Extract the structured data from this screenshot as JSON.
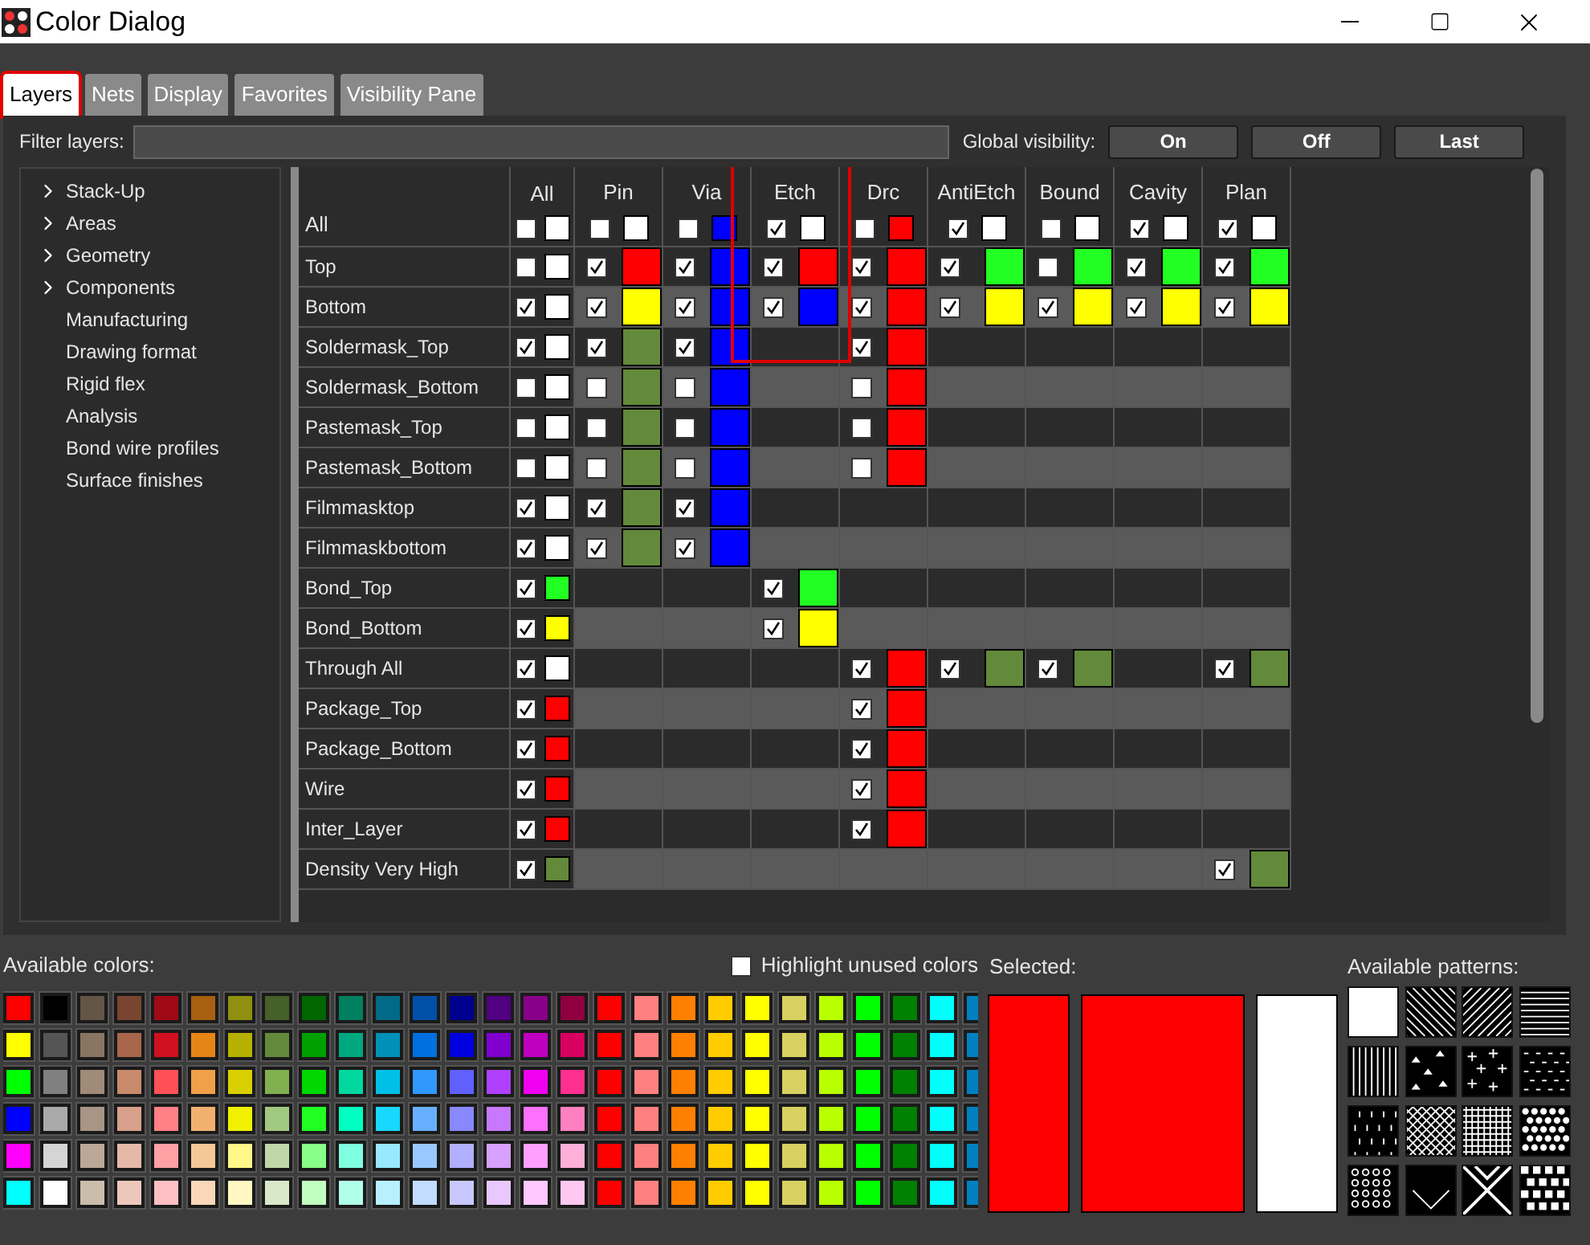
{
  "window": {
    "title": "Color Dialog"
  },
  "tabs": [
    {
      "label": "Layers",
      "selected": true,
      "highlighted": true
    },
    {
      "label": "Nets",
      "selected": false,
      "highlighted": false
    },
    {
      "label": "Display",
      "selected": false,
      "highlighted": false
    },
    {
      "label": "Favorites",
      "selected": false,
      "highlighted": false
    },
    {
      "label": "Visibility Pane",
      "selected": false,
      "highlighted": false
    }
  ],
  "filter": {
    "label": "Filter layers:"
  },
  "global_visibility": {
    "label": "Global visibility:",
    "buttons": [
      "On",
      "Off",
      "Last"
    ]
  },
  "tree": [
    {
      "label": "Stack-Up",
      "kind": "group"
    },
    {
      "label": "Areas",
      "kind": "group"
    },
    {
      "label": "Geometry",
      "kind": "group"
    },
    {
      "label": "Components",
      "kind": "group"
    },
    {
      "label": "Manufacturing",
      "kind": "leaf"
    },
    {
      "label": "Drawing format",
      "kind": "leaf"
    },
    {
      "label": "Rigid flex",
      "kind": "leaf"
    },
    {
      "label": "Analysis",
      "kind": "leaf"
    },
    {
      "label": "Bond wire profiles",
      "kind": "leaf"
    },
    {
      "label": "Surface finishes",
      "kind": "leaf"
    }
  ],
  "grid": {
    "all_row_label": "All",
    "all_column": {
      "label": "All",
      "checked": false,
      "color": "#ffffff"
    },
    "columns": [
      {
        "label": "Pin",
        "checked": false,
        "color": "#ffffff"
      },
      {
        "label": "Via",
        "checked": false,
        "color": "#0000ff"
      },
      {
        "label": "Etch",
        "checked": true,
        "color": "#ffffff",
        "highlighted": true
      },
      {
        "label": "Drc",
        "checked": false,
        "color": "#ff0000"
      },
      {
        "label": "AntiEtch",
        "checked": true,
        "color": "#ffffff"
      },
      {
        "label": "Bound",
        "checked": false,
        "color": "#ffffff"
      },
      {
        "label": "Cavity",
        "checked": true,
        "color": "#ffffff"
      },
      {
        "label": "Plan",
        "checked": true,
        "color": "#ffffff"
      }
    ],
    "rows": [
      {
        "name": "Top",
        "all": {
          "checked": false,
          "color": "#ffffff"
        },
        "cells": [
          {
            "checked": true,
            "color": "#ff0000"
          },
          {
            "checked": true,
            "color": "#0000ff"
          },
          {
            "checked": true,
            "color": "#ff0000"
          },
          {
            "checked": true,
            "color": "#ff0000"
          },
          {
            "checked": true,
            "color": "#22ff22"
          },
          {
            "checked": false,
            "color": "#22ff22"
          },
          {
            "checked": true,
            "color": "#22ff22"
          },
          {
            "checked": true,
            "color": "#22ff22"
          }
        ]
      },
      {
        "name": "Bottom",
        "all": {
          "checked": true,
          "color": "#ffffff"
        },
        "cells": [
          {
            "checked": true,
            "color": "#ffff00"
          },
          {
            "checked": true,
            "color": "#0000ff"
          },
          {
            "checked": true,
            "color": "#0000ff"
          },
          {
            "checked": true,
            "color": "#ff0000"
          },
          {
            "checked": true,
            "color": "#ffff00"
          },
          {
            "checked": true,
            "color": "#ffff00"
          },
          {
            "checked": true,
            "color": "#ffff00"
          },
          {
            "checked": true,
            "color": "#ffff00"
          }
        ]
      },
      {
        "name": "Soldermask_Top",
        "all": {
          "checked": true,
          "color": "#ffffff"
        },
        "cells": [
          {
            "checked": true,
            "color": "#628a3a"
          },
          {
            "checked": true,
            "color": "#0000ff"
          },
          null,
          {
            "checked": true,
            "color": "#ff0000"
          },
          null,
          null,
          null,
          null
        ]
      },
      {
        "name": "Soldermask_Bottom",
        "all": {
          "checked": false,
          "color": "#ffffff"
        },
        "cells": [
          {
            "checked": false,
            "color": "#628a3a"
          },
          {
            "checked": false,
            "color": "#0000ff"
          },
          null,
          {
            "checked": false,
            "color": "#ff0000"
          },
          null,
          null,
          null,
          null
        ]
      },
      {
        "name": "Pastemask_Top",
        "all": {
          "checked": false,
          "color": "#ffffff"
        },
        "cells": [
          {
            "checked": false,
            "color": "#628a3a"
          },
          {
            "checked": false,
            "color": "#0000ff"
          },
          null,
          {
            "checked": false,
            "color": "#ff0000"
          },
          null,
          null,
          null,
          null
        ]
      },
      {
        "name": "Pastemask_Bottom",
        "all": {
          "checked": false,
          "color": "#ffffff"
        },
        "cells": [
          {
            "checked": false,
            "color": "#628a3a"
          },
          {
            "checked": false,
            "color": "#0000ff"
          },
          null,
          {
            "checked": false,
            "color": "#ff0000"
          },
          null,
          null,
          null,
          null
        ]
      },
      {
        "name": "Filmmasktop",
        "all": {
          "checked": true,
          "color": "#ffffff"
        },
        "cells": [
          {
            "checked": true,
            "color": "#628a3a"
          },
          {
            "checked": true,
            "color": "#0000ff"
          },
          null,
          null,
          null,
          null,
          null,
          null
        ]
      },
      {
        "name": "Filmmaskbottom",
        "all": {
          "checked": true,
          "color": "#ffffff"
        },
        "cells": [
          {
            "checked": true,
            "color": "#628a3a"
          },
          {
            "checked": true,
            "color": "#0000ff"
          },
          null,
          null,
          null,
          null,
          null,
          null
        ]
      },
      {
        "name": "Bond_Top",
        "all": {
          "checked": true,
          "color": "#22ff22"
        },
        "cells": [
          null,
          null,
          {
            "checked": true,
            "color": "#22ff22"
          },
          null,
          null,
          null,
          null,
          null
        ]
      },
      {
        "name": "Bond_Bottom",
        "all": {
          "checked": true,
          "color": "#ffff00"
        },
        "cells": [
          null,
          null,
          {
            "checked": true,
            "color": "#ffff00"
          },
          null,
          null,
          null,
          null,
          null
        ]
      },
      {
        "name": "Through All",
        "all": {
          "checked": true,
          "color": "#ffffff"
        },
        "cells": [
          null,
          null,
          null,
          {
            "checked": true,
            "color": "#ff0000"
          },
          {
            "checked": true,
            "color": "#628a3a"
          },
          {
            "checked": true,
            "color": "#628a3a"
          },
          null,
          {
            "checked": true,
            "color": "#628a3a"
          }
        ]
      },
      {
        "name": "Package_Top",
        "all": {
          "checked": true,
          "color": "#ff0000"
        },
        "cells": [
          null,
          null,
          null,
          {
            "checked": true,
            "color": "#ff0000"
          },
          null,
          null,
          null,
          null
        ]
      },
      {
        "name": "Package_Bottom",
        "all": {
          "checked": true,
          "color": "#ff0000"
        },
        "cells": [
          null,
          null,
          null,
          {
            "checked": true,
            "color": "#ff0000"
          },
          null,
          null,
          null,
          null
        ]
      },
      {
        "name": "Wire",
        "all": {
          "checked": true,
          "color": "#ff0000"
        },
        "cells": [
          null,
          null,
          null,
          {
            "checked": true,
            "color": "#ff0000"
          },
          null,
          null,
          null,
          null
        ]
      },
      {
        "name": "Inter_Layer",
        "all": {
          "checked": true,
          "color": "#ff0000"
        },
        "cells": [
          null,
          null,
          null,
          {
            "checked": true,
            "color": "#ff0000"
          },
          null,
          null,
          null,
          null
        ]
      },
      {
        "name": "Density Very High",
        "all": {
          "checked": true,
          "color": "#628a3a"
        },
        "cells": [
          null,
          null,
          null,
          null,
          null,
          null,
          null,
          {
            "checked": true,
            "color": "#628a3a"
          }
        ]
      }
    ]
  },
  "available_colors": {
    "label": "Available colors:",
    "rows": [
      {
        "swatches": [
          {
            "color": "#ff0000"
          },
          {
            "color": "#000000"
          },
          {
            "color": "#645547"
          },
          {
            "color": "#7a4530"
          },
          {
            "color": "#a00a15"
          },
          {
            "color": "#a66010"
          },
          {
            "color": "#909010"
          },
          {
            "color": "#456028"
          },
          {
            "color": "#006600"
          },
          {
            "color": "#008060"
          },
          {
            "color": "#006a88"
          },
          {
            "color": "#0050a8"
          },
          {
            "color": "#000090"
          },
          {
            "color": "#500080"
          },
          {
            "color": "#880088"
          },
          {
            "color": "#900040"
          },
          {
            "color": "#ff0000"
          },
          {
            "color": "#ff8080"
          },
          {
            "color": "#ff8000"
          },
          {
            "color": "#ffcc00"
          },
          {
            "color": "#ffff00"
          },
          {
            "color": "#d8d060"
          },
          {
            "color": "#b8ff00"
          },
          {
            "color": "#00ff00"
          },
          {
            "color": "#008000"
          },
          {
            "color": "#00ffff"
          },
          {
            "color": "#0080c0"
          }
        ]
      },
      {
        "swatches": [
          {
            "color": "#ffff00"
          },
          {
            "color": "#555555"
          },
          {
            "color": "#8a7563"
          },
          {
            "color": "#a8664a"
          },
          {
            "color": "#d01020"
          },
          {
            "color": "#e58515"
          },
          {
            "color": "#b8b000"
          },
          {
            "color": "#628a3a"
          },
          {
            "color": "#00a000"
          },
          {
            "color": "#00a880"
          },
          {
            "color": "#0090b8"
          },
          {
            "color": "#0070e0"
          },
          {
            "color": "#0000e0"
          },
          {
            "color": "#8000d0"
          },
          {
            "color": "#c000c0"
          },
          {
            "color": "#d80060"
          },
          {
            "color": "#ff0000"
          },
          {
            "color": "#ff8080"
          },
          {
            "color": "#ff8000"
          },
          {
            "color": "#ffcc00"
          },
          {
            "color": "#ffff00"
          },
          {
            "color": "#d8d060"
          },
          {
            "color": "#b8ff00"
          },
          {
            "color": "#00ff00"
          },
          {
            "color": "#008000"
          },
          {
            "color": "#00ffff"
          },
          {
            "color": "#0080c0"
          }
        ]
      },
      {
        "swatches": [
          {
            "color": "#00ff00"
          },
          {
            "color": "#808080"
          },
          {
            "color": "#a08a78"
          },
          {
            "color": "#c98a6c"
          },
          {
            "color": "#ff5058"
          },
          {
            "color": "#f0a048"
          },
          {
            "color": "#d8d000"
          },
          {
            "color": "#80b050"
          },
          {
            "color": "#00d800"
          },
          {
            "color": "#00d8a0"
          },
          {
            "color": "#00c0e8"
          },
          {
            "color": "#3098ff"
          },
          {
            "color": "#6060ff"
          },
          {
            "color": "#b040ff"
          },
          {
            "color": "#f000f0"
          },
          {
            "color": "#ff3090"
          },
          {
            "color": "#ff0000"
          },
          {
            "color": "#ff8080"
          },
          {
            "color": "#ff8000"
          },
          {
            "color": "#ffcc00"
          },
          {
            "color": "#ffff00"
          },
          {
            "color": "#d8d060"
          },
          {
            "color": "#b8ff00"
          },
          {
            "color": "#00ff00"
          },
          {
            "color": "#008000"
          },
          {
            "color": "#00ffff"
          },
          {
            "color": "#0080c0"
          }
        ]
      },
      {
        "swatches": [
          {
            "color": "#0000ff"
          },
          {
            "color": "#aaaaaa"
          },
          {
            "color": "#a89585"
          },
          {
            "color": "#d8a08a"
          },
          {
            "color": "#ff8085"
          },
          {
            "color": "#f2b070"
          },
          {
            "color": "#f0f000"
          },
          {
            "color": "#a0c880"
          },
          {
            "color": "#22ff22"
          },
          {
            "color": "#00ffc0"
          },
          {
            "color": "#18d8ff"
          },
          {
            "color": "#68b0ff"
          },
          {
            "color": "#8888ff"
          },
          {
            "color": "#c878ff"
          },
          {
            "color": "#ff70ff"
          },
          {
            "color": "#ff80c0"
          },
          {
            "color": "#ff0000"
          },
          {
            "color": "#ff8080"
          },
          {
            "color": "#ff8000"
          },
          {
            "color": "#ffcc00"
          },
          {
            "color": "#ffff00"
          },
          {
            "color": "#d8d060"
          },
          {
            "color": "#b8ff00"
          },
          {
            "color": "#00ff00"
          },
          {
            "color": "#008000"
          },
          {
            "color": "#00ffff"
          },
          {
            "color": "#0080c0"
          }
        ]
      },
      {
        "swatches": [
          {
            "color": "#ff00ff"
          },
          {
            "color": "#d5d5d5"
          },
          {
            "color": "#bba898"
          },
          {
            "color": "#e6b8a8"
          },
          {
            "color": "#ffa0a5"
          },
          {
            "color": "#f5c898"
          },
          {
            "color": "#fff888"
          },
          {
            "color": "#c0d8a8"
          },
          {
            "color": "#88ff88"
          },
          {
            "color": "#80ffe0"
          },
          {
            "color": "#98e8ff"
          },
          {
            "color": "#98c8ff"
          },
          {
            "color": "#b0b0ff"
          },
          {
            "color": "#d8a0ff"
          },
          {
            "color": "#ffa0ff"
          },
          {
            "color": "#ffb0d8"
          },
          {
            "color": "#ff0000"
          },
          {
            "color": "#ff8080"
          },
          {
            "color": "#ff8000"
          },
          {
            "color": "#ffcc00"
          },
          {
            "color": "#ffff00"
          },
          {
            "color": "#d8d060"
          },
          {
            "color": "#b8ff00"
          },
          {
            "color": "#00ff00"
          },
          {
            "color": "#008000"
          },
          {
            "color": "#00ffff"
          },
          {
            "color": "#0080c0"
          }
        ]
      },
      {
        "swatches": [
          {
            "color": "#00ffff"
          },
          {
            "color": "#ffffff"
          },
          {
            "color": "#cabdab"
          },
          {
            "color": "#ecc8bc"
          },
          {
            "color": "#ffc0c5"
          },
          {
            "color": "#f8d8b8"
          },
          {
            "color": "#fff8c0"
          },
          {
            "color": "#d8e8c8"
          },
          {
            "color": "#c0ffc0"
          },
          {
            "color": "#b0ffe8"
          },
          {
            "color": "#b8f0ff"
          },
          {
            "color": "#c0dcff"
          },
          {
            "color": "#c8c8ff"
          },
          {
            "color": "#e8c8ff"
          },
          {
            "color": "#ffc8ff"
          },
          {
            "color": "#ffc8f0"
          },
          {
            "color": "#ff0000"
          },
          {
            "color": "#ff8080"
          },
          {
            "color": "#ff8000"
          },
          {
            "color": "#ffcc00"
          },
          {
            "color": "#ffff00"
          },
          {
            "color": "#d8d060"
          },
          {
            "color": "#b8ff00"
          },
          {
            "color": "#00ff00"
          },
          {
            "color": "#008000"
          },
          {
            "color": "#00ffff"
          },
          {
            "color": "#0080c0"
          }
        ]
      }
    ]
  },
  "highlight_unused": {
    "label": "Highlight unused colors",
    "checked": false
  },
  "selected": {
    "label": "Selected:",
    "swatches": [
      {
        "color": "#ff0000"
      },
      {
        "color": "#ff0000"
      },
      {
        "color": "#ffffff"
      }
    ]
  },
  "patterns": {
    "label": "Available patterns:",
    "items": [
      {
        "kind": "solid"
      },
      {
        "kind": "diag-back"
      },
      {
        "kind": "diag-fwd"
      },
      {
        "kind": "horizontal"
      },
      {
        "kind": "vertical"
      },
      {
        "kind": "triangles"
      },
      {
        "kind": "crosses"
      },
      {
        "kind": "dashes"
      },
      {
        "kind": "ticks"
      },
      {
        "kind": "crosshatch"
      },
      {
        "kind": "grid"
      },
      {
        "kind": "dots"
      },
      {
        "kind": "rings"
      },
      {
        "kind": "diamond"
      },
      {
        "kind": "lattice"
      },
      {
        "kind": "checker"
      }
    ]
  }
}
